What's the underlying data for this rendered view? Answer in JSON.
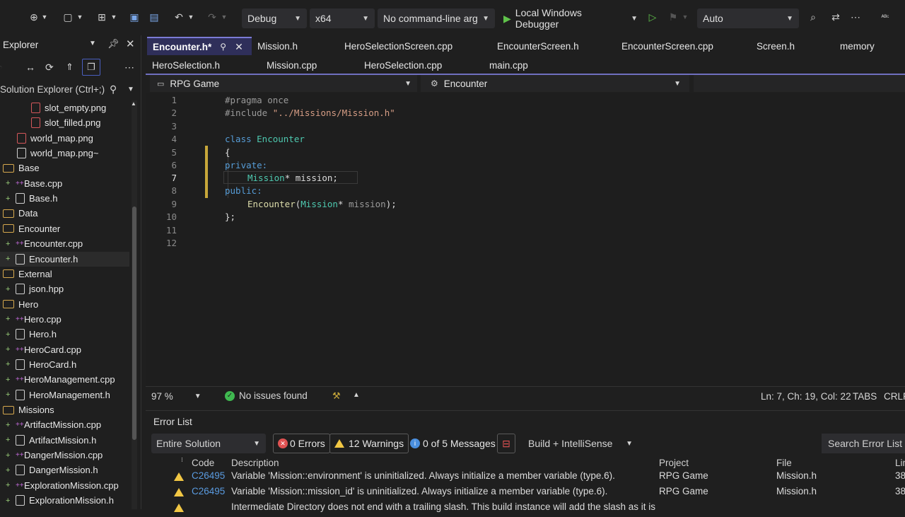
{
  "toolbar": {
    "config": "Debug",
    "platform": "x64",
    "args": "No command-line arg",
    "debugger": "Local Windows Debugger",
    "auto": "Auto"
  },
  "solution_explorer": {
    "title": "Explorer",
    "search_placeholder": "Solution Explorer (Ctrl+;)",
    "items": [
      {
        "label": "slot_empty.png",
        "type": "png"
      },
      {
        "label": "slot_filled.png",
        "type": "png"
      },
      {
        "label": "world_map.png",
        "type": "png"
      },
      {
        "label": "world_map.png~",
        "type": "file"
      },
      {
        "label": "Base",
        "type": "folder"
      },
      {
        "label": "Base.cpp",
        "type": "cpp"
      },
      {
        "label": "Base.h",
        "type": "h"
      },
      {
        "label": "Data",
        "type": "folder"
      },
      {
        "label": "Encounter",
        "type": "folder"
      },
      {
        "label": "Encounter.cpp",
        "type": "cpp"
      },
      {
        "label": "Encounter.h",
        "type": "h"
      },
      {
        "label": "External",
        "type": "folder"
      },
      {
        "label": "json.hpp",
        "type": "h"
      },
      {
        "label": "Hero",
        "type": "folder"
      },
      {
        "label": "Hero.cpp",
        "type": "cpp"
      },
      {
        "label": "Hero.h",
        "type": "h"
      },
      {
        "label": "HeroCard.cpp",
        "type": "cpp"
      },
      {
        "label": "HeroCard.h",
        "type": "h"
      },
      {
        "label": "HeroManagement.cpp",
        "type": "cpp"
      },
      {
        "label": "HeroManagement.h",
        "type": "h"
      },
      {
        "label": "Missions",
        "type": "folder"
      },
      {
        "label": "ArtifactMission.cpp",
        "type": "cpp"
      },
      {
        "label": "ArtifactMission.h",
        "type": "h"
      },
      {
        "label": "DangerMission.cpp",
        "type": "cpp"
      },
      {
        "label": "DangerMission.h",
        "type": "h"
      },
      {
        "label": "ExplorationMission.cpp",
        "type": "cpp"
      },
      {
        "label": "ExplorationMission.h",
        "type": "h"
      }
    ]
  },
  "tabs": {
    "row1": [
      "Encounter.h*",
      "Mission.h",
      "HeroSelectionScreen.cpp",
      "EncounterScreen.h",
      "EncounterScreen.cpp",
      "Screen.h",
      "memory"
    ],
    "row2": [
      "HeroSelection.h",
      "Mission.cpp",
      "HeroSelection.cpp",
      "main.cpp"
    ]
  },
  "navbar": {
    "project": "RPG Game",
    "scope": "Encounter"
  },
  "code": {
    "lines": [
      "1",
      "2",
      "3",
      "4",
      "5",
      "6",
      "7",
      "8",
      "9",
      "10",
      "11",
      "12"
    ],
    "l1": "#pragma once",
    "l2a": "#include ",
    "l2b": "\"../Missions/Mission.h\"",
    "l4a": "class ",
    "l4b": "Encounter",
    "l5": "{",
    "l6": "private:",
    "l7a": "Mission",
    "l7b": "* mission;",
    "l8": "public:",
    "l9a": "Encounter",
    "l9b": "(",
    "l9c": "Mission",
    "l9d": "* ",
    "l9e": "mission",
    "l9f": ");",
    "l10": "};"
  },
  "status": {
    "zoom": "97 %",
    "issues": "No issues found",
    "position": "Ln: 7, Ch: 19, Col: 22",
    "tabs": "TABS",
    "eol": "CRLF"
  },
  "error_list": {
    "title": "Error List",
    "scope": "Entire Solution",
    "errors": "0 Errors",
    "warnings": "12 Warnings",
    "messages": "0 of 5 Messages",
    "build": "Build + IntelliSense",
    "search": "Search Error List",
    "headers": {
      "code": "Code",
      "description": "Description",
      "project": "Project",
      "file": "File",
      "line": "Lin"
    },
    "rows": [
      {
        "code": "C26495",
        "description": "Variable 'Mission::environment' is uninitialized. Always initialize a member variable (type.6).",
        "project": "RPG Game",
        "file": "Mission.h",
        "line": "38"
      },
      {
        "code": "C26495",
        "description": "Variable 'Mission::mission_id' is uninitialized. Always initialize a member variable (type.6).",
        "project": "RPG Game",
        "file": "Mission.h",
        "line": "38"
      },
      {
        "code": "",
        "description": "Intermediate Directory does not end with a trailing slash.  This build instance will add the slash as it is",
        "project": "",
        "file": "",
        "line": ""
      }
    ]
  }
}
